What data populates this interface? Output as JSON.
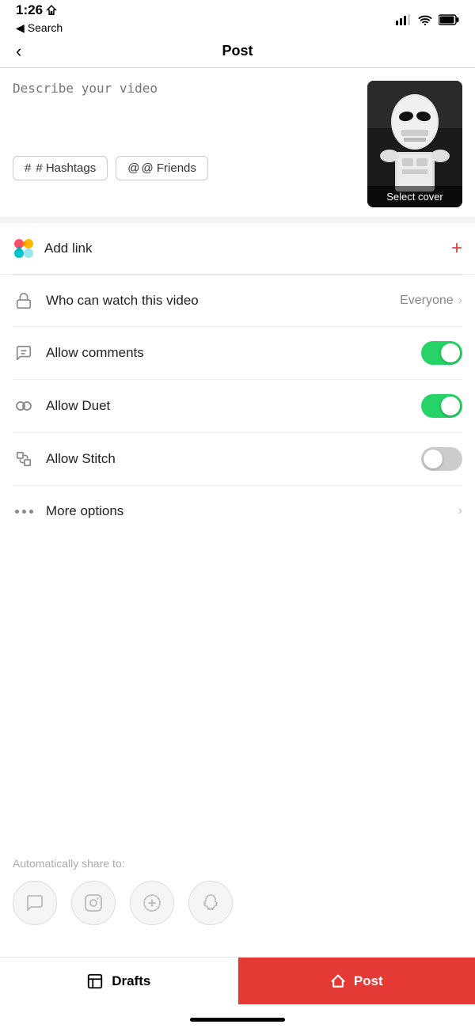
{
  "statusBar": {
    "time": "1:26",
    "locationIcon": "◀",
    "backLabel": "Search"
  },
  "navBar": {
    "backIcon": "<",
    "title": "Post"
  },
  "descriptionArea": {
    "placeholder": "Describe your video",
    "hashtagsLabel": "# Hashtags",
    "friendsLabel": "@ Friends",
    "selectCoverLabel": "Select cover"
  },
  "addLink": {
    "label": "Add link",
    "plusIcon": "+"
  },
  "settings": {
    "whoCanWatch": {
      "label": "Who can watch this video",
      "value": "Everyone"
    },
    "allowComments": {
      "label": "Allow comments",
      "enabled": true
    },
    "allowDuet": {
      "label": "Allow Duet",
      "enabled": true
    },
    "allowStitch": {
      "label": "Allow Stitch",
      "enabled": false
    },
    "moreOptions": {
      "label": "More options"
    }
  },
  "autoShare": {
    "label": "Automatically share to:"
  },
  "bottomBar": {
    "draftsLabel": "Drafts",
    "postLabel": "Post"
  }
}
